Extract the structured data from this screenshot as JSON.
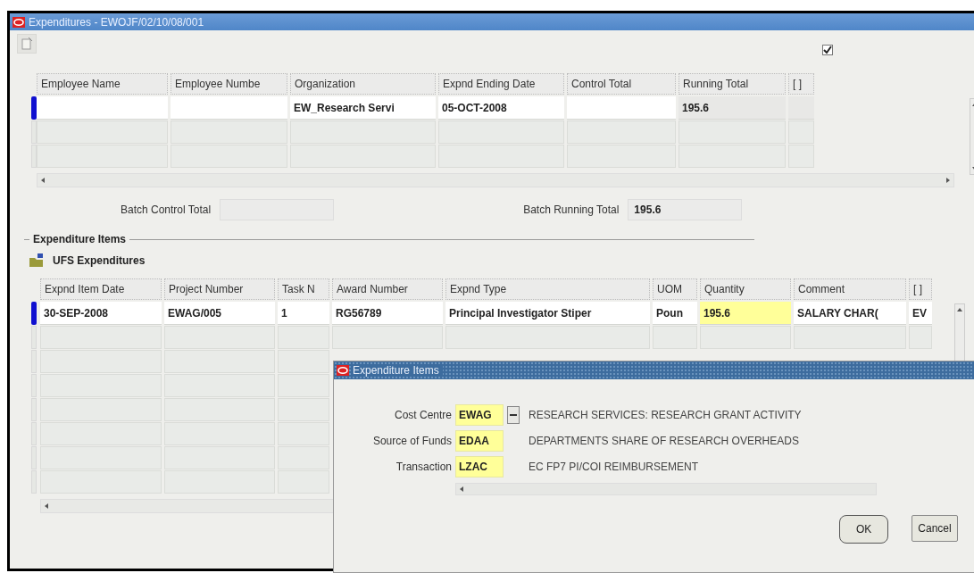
{
  "window": {
    "title": "Expenditures - EWOJF/02/10/08/001"
  },
  "toolbar": {
    "checkbox": {
      "checked": true
    }
  },
  "header_table": {
    "columns": [
      "Employee Name",
      "Employee Numbe",
      "Organization",
      "Expnd Ending Date",
      "Control Total",
      "Running Total",
      "[ ]"
    ],
    "rows": [
      {
        "current": true,
        "cells": [
          {
            "kind": "editable"
          },
          {
            "kind": "editable"
          },
          {
            "kind": "editable",
            "text": "EW_Research Servi"
          },
          {
            "kind": "editable",
            "text": "05-OCT-2008"
          },
          {
            "kind": "editable"
          },
          {
            "kind": "readonly",
            "text": "195.6"
          },
          {
            "kind": "readonly"
          }
        ]
      }
    ]
  },
  "batch": {
    "control_total": {
      "label": "Batch Control Total"
    },
    "running_total": {
      "label": "Batch Running Total",
      "value": "195.6"
    }
  },
  "section": {
    "title": "Expenditure Items",
    "subtitle": "UFS Expenditures"
  },
  "items_table": {
    "columns": [
      "Expnd Item Date",
      "Project Number",
      "Task N",
      "Award Number",
      "Expnd Type",
      "UOM",
      "Quantity",
      "Comment",
      "[ ]"
    ],
    "rows": [
      {
        "current": true,
        "cells": [
          {
            "kind": "editable",
            "text": "30-SEP-2008"
          },
          {
            "kind": "editable",
            "text": "EWAG/005"
          },
          {
            "kind": "editable",
            "text": "1"
          },
          {
            "kind": "editable",
            "text": "RG56789"
          },
          {
            "kind": "editable",
            "text": "Principal Investigator Stiper"
          },
          {
            "kind": "editable",
            "text": "Poun"
          },
          {
            "kind": "required",
            "text": "195.6"
          },
          {
            "kind": "editable",
            "text": "SALARY CHAR("
          },
          {
            "kind": "editable",
            "text": "EV"
          }
        ]
      }
    ]
  },
  "dialog": {
    "title": "Expenditure Items",
    "fields": [
      {
        "label": "Cost Centre",
        "value": "EWAG",
        "list_button": true,
        "description": "RESEARCH SERVICES: RESEARCH GRANT ACTIVITY"
      },
      {
        "label": "Source of Funds",
        "value": "EDAA",
        "list_button": false,
        "description": "DEPARTMENTS SHARE OF RESEARCH OVERHEADS"
      },
      {
        "label": "Transaction",
        "value": "LZAC",
        "list_button": false,
        "description": "EC FP7 PI/COI REIMBURSEMENT"
      }
    ],
    "buttons": [
      "OK",
      "Cancel"
    ]
  }
}
